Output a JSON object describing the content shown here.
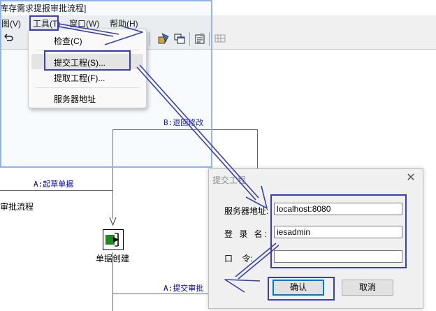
{
  "window": {
    "title": "库存需求提报审批流程]"
  },
  "menubar": {
    "items": [
      {
        "label": "图(V)"
      },
      {
        "label": "工具(T)"
      },
      {
        "label": "窗口(W)"
      },
      {
        "label": "帮助(H)"
      }
    ]
  },
  "tools_menu": {
    "items": [
      {
        "label": "检查(C)"
      },
      {
        "label": "提交工程(S)..."
      },
      {
        "label": "提取工程(F)..."
      },
      {
        "label": "服务器地址"
      }
    ]
  },
  "workflow": {
    "process_name": "审批流程",
    "transitions": [
      {
        "label": "B:退回修改"
      },
      {
        "label": "A:起草单据"
      },
      {
        "label": "A:提交审批"
      }
    ],
    "node": {
      "label": "单据创建",
      "icon": "exit-arrow-icon"
    }
  },
  "dialog": {
    "title": "提交工程",
    "fields": {
      "server": {
        "label": "服务器地址:",
        "value": "localhost:8080"
      },
      "login": {
        "label": "登 录 名:",
        "value": "iesadmin"
      },
      "password": {
        "label": "口    令:",
        "value": ""
      }
    },
    "ok_label": "确认",
    "cancel_label": "取消"
  },
  "colors": {
    "annotation": "#3a3fb0",
    "flow_label": "#0000aa",
    "node_icon": "#1c8a1c"
  }
}
